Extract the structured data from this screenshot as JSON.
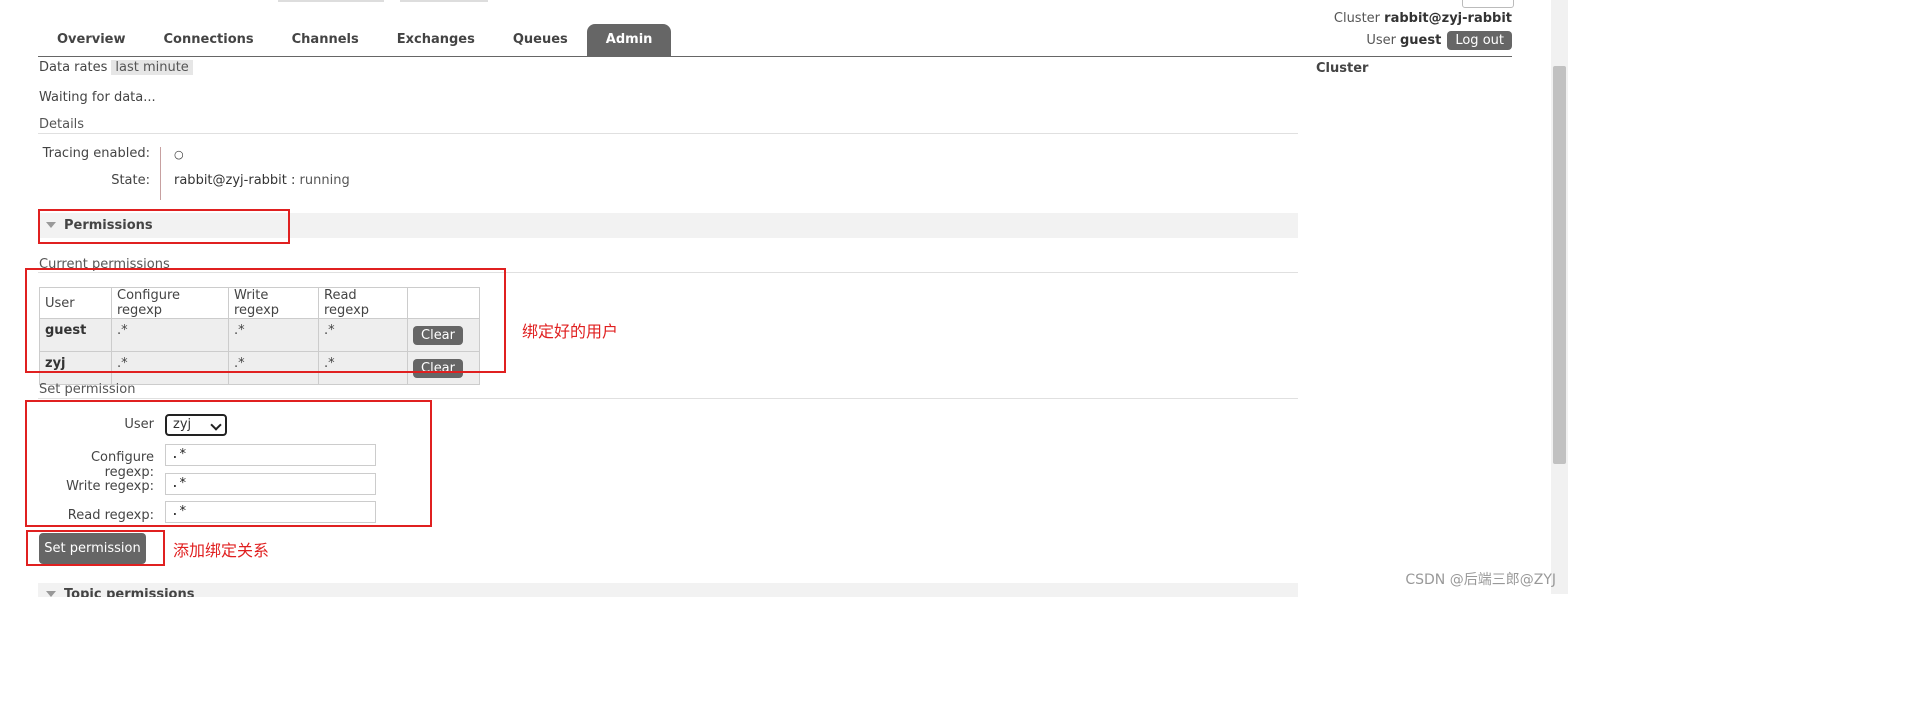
{
  "header": {
    "cluster_label": "Cluster",
    "cluster_name": "rabbit@zyj-rabbit",
    "user_label": "User",
    "user_name": "guest",
    "logout_label": "Log out"
  },
  "tabs": [
    {
      "label": "Overview"
    },
    {
      "label": "Connections"
    },
    {
      "label": "Channels"
    },
    {
      "label": "Exchanges"
    },
    {
      "label": "Queues"
    },
    {
      "label": "Admin",
      "active": true
    }
  ],
  "rates": {
    "label": "Data rates",
    "period": "last minute"
  },
  "sidebar": {
    "cluster_title": "Cluster"
  },
  "waiting_text": "Waiting for data...",
  "details": {
    "title": "Details",
    "tracing_label": "Tracing enabled:",
    "tracing_value": "○",
    "state_label": "State:",
    "state_node": "rabbit@zyj-rabbit :",
    "state_value": "running"
  },
  "permissions": {
    "title": "Permissions",
    "current_label": "Current permissions",
    "columns": [
      "User",
      "Configure regexp",
      "Write regexp",
      "Read regexp"
    ],
    "rows": [
      {
        "user": "guest",
        "configure": ".*",
        "write": ".*",
        "read": ".*",
        "action": "Clear"
      },
      {
        "user": "zyj",
        "configure": ".*",
        "write": ".*",
        "read": ".*",
        "action": "Clear"
      }
    ]
  },
  "set_permission": {
    "title": "Set permission",
    "user_label": "User",
    "user_selected": "zyj",
    "configure_label": "Configure regexp:",
    "configure_value": ".*",
    "write_label": "Write regexp:",
    "write_value": ".*",
    "read_label": "Read regexp:",
    "read_value": ".*",
    "submit_label": "Set permission"
  },
  "annotations": {
    "bound_users": "绑定好的用户",
    "add_binding": "添加绑定关系"
  },
  "topic_permissions": {
    "title": "Topic permissions"
  },
  "watermark": "CSDN @后端三郎@ZYJ",
  "colors": {
    "accent": "#666666",
    "annotation_red": "#e02020"
  }
}
